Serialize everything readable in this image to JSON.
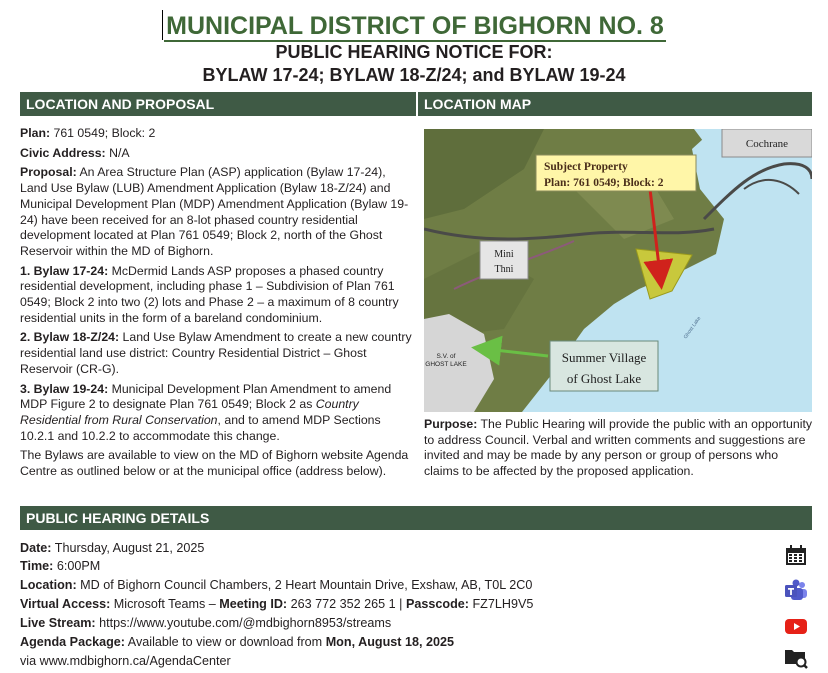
{
  "header": {
    "title": "MUNICIPAL DISTRICT OF BIGHORN NO. 8",
    "subtitle1": "PUBLIC HEARING NOTICE FOR:",
    "subtitle2": "BYLAW 17-24; BYLAW 18-Z/24; and BYLAW 19-24"
  },
  "sections": {
    "location_proposal": "LOCATION AND PROPOSAL",
    "location_map": "LOCATION MAP",
    "hearing_details": "PUBLIC HEARING DETAILS"
  },
  "proposal": {
    "plan_label": "Plan:",
    "plan_value": " 761 0549; Block: 2",
    "civic_label": "Civic Address:",
    "civic_value": " N/A",
    "proposal_label": "Proposal:",
    "proposal_text": " An Area Structure Plan (ASP) application (Bylaw 17-24), Land Use Bylaw (LUB) Amendment Application (Bylaw 18-Z/24) and Municipal Development Plan (MDP) Amendment Application (Bylaw 19-24) have been received for an 8-lot phased country residential development located at Plan 761 0549; Block 2, north of the Ghost Reservoir within the MD of Bighorn.",
    "b1_label": "1. Bylaw 17-24:",
    "b1_text": " McDermid Lands ASP proposes a phased country residential development, including phase 1 – Subdivision of Plan 761 0549; Block 2 into two (2) lots and Phase 2 – a maximum of 8 country residential units in the form of a bareland condominium.",
    "b2_label": "2. Bylaw 18-Z/24:",
    "b2_text": " Land Use Bylaw Amendment to create a new country residential land use district: Country Residential District – Ghost Reservoir (CR-G).",
    "b3_label": "3. Bylaw 19-24:",
    "b3_text_a": " Municipal Development Plan Amendment to amend MDP Figure 2 to designate Plan 761 0549; Block 2 as ",
    "b3_italic": "Country Residential from Rural Conservation",
    "b3_text_b": ", and to amend MDP Sections 10.2.1 and 10.2.2 to accommodate this change.",
    "bylaws_text": "The Bylaws are available to view on the MD of Bighorn website Agenda Centre as outlined below or at the municipal office (address below)."
  },
  "map": {
    "cochrane": "Cochrane",
    "subject_line1": "Subject Property",
    "subject_line2": "Plan: 761 0549; Block: 2",
    "mini": "Mini",
    "thni": "Thni",
    "sv_small1": "S.V. of",
    "sv_small2": "GHOST LAKE",
    "summer1": "Summer Village",
    "summer2": "of Ghost Lake",
    "lake_label": "Ghost Lake"
  },
  "purpose": {
    "label": "Purpose:",
    "text": " The Public Hearing will provide the public with an opportunity to address Council. Verbal and written comments and suggestions are invited and may be made by any person or group of persons who claims to be affected by the proposed application."
  },
  "details": {
    "date_label": "Date:",
    "date_value": " Thursday, August 21, 2025",
    "time_label": "Time:",
    "time_value": " 6:00PM",
    "location_label": "Location:",
    "location_value": " MD of Bighorn Council Chambers, 2 Heart Mountain Drive, Exshaw, AB, T0L 2C0",
    "virtual_label": "Virtual Access:",
    "virtual_value": " Microsoft Teams – ",
    "meeting_label": "Meeting ID:",
    "meeting_value": " 263 772 352 265 1 | ",
    "passcode_label": "Passcode:",
    "passcode_value": " FZ7LH9V5",
    "stream_label": "Live Stream:",
    "stream_value": " https://www.youtube.com/@mdbighorn8953/streams",
    "agenda_label": "Agenda Package:",
    "agenda_value": " Available to view or download from ",
    "agenda_date": "Mon, August 18, 2025",
    "agenda_via": "via www.mdbighorn.ca/AgendaCenter"
  },
  "colors": {
    "title_green": "#3f6837",
    "bar_green": "#3f5a45",
    "lake_blue": "#bfe3f1",
    "subject_yellow": "#fff6a8",
    "arrow_red": "#d0221c",
    "arrow_green": "#6abf45"
  },
  "icons": [
    "calendar-icon",
    "teams-icon",
    "youtube-icon",
    "folder-search-icon"
  ]
}
